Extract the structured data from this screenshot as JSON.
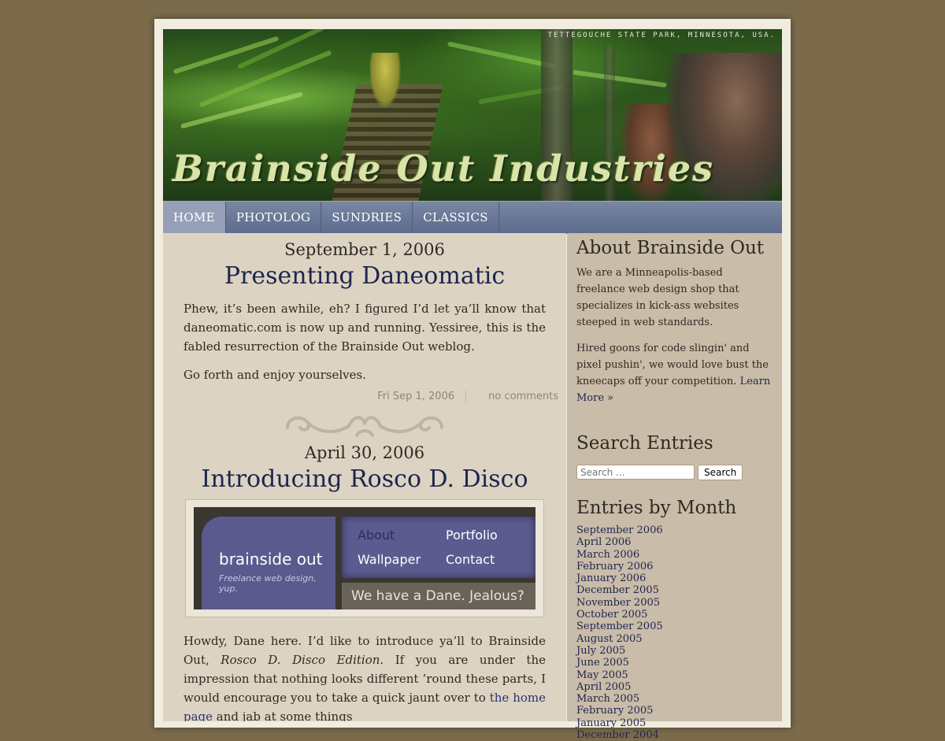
{
  "header": {
    "location": "TETTEGOUCHE STATE PARK, MINNESOTA, USA.",
    "site_title": "Brainside Out Industries"
  },
  "nav": {
    "items": [
      "HOME",
      "PHOTOLOG",
      "SUNDRIES",
      "CLASSICS"
    ],
    "active": "HOME"
  },
  "posts": [
    {
      "date": "September 1, 2006",
      "title": "Presenting Daneomatic",
      "p1_a": "Phew, it’s been awhile, eh? I figured I’d let ya’ll know that ",
      "p1_link": "daneomatic.com",
      "p1_b": " is now up and running. Yessiree, this is the fabled resurrection of the Brainside Out weblog.",
      "p2": "Go forth and enjoy yourselves.",
      "meta_date": "Fri Sep 1, 2006",
      "meta_comments": "no comments"
    },
    {
      "date": "April 30, 2006",
      "title": "Introducing Rosco D. Disco",
      "screenshot": {
        "logo": "brainside out",
        "tagline": "Freelance web design, yup.",
        "menu": [
          "About",
          "Portfolio",
          "Wallpaper",
          "Contact"
        ],
        "footer": "We have a Dane. Jealous?"
      },
      "p1_a": "Howdy, Dane here. I’d like to introduce ya’ll to Brainside Out, ",
      "p1_em": "Rosco D. Disco Edition",
      "p1_b": ". If you are under the impression that nothing looks different ’round these parts, I would encourage you to take a quick jaunt over to ",
      "p1_link": "the home page",
      "p1_c": " and jab at some things"
    }
  ],
  "sidebar": {
    "about_title": "About Brainside Out",
    "about_p1": "We are a Minneapolis-based freelance web design shop that specializes in kick-ass websites steeped in web standards.",
    "about_p2": "Hired goons for code slingin' and pixel pushin', we would love bust the kneecaps off your competition.",
    "learn_more": "Learn More »",
    "search_title": "Search Entries",
    "search_placeholder": "Search ...",
    "search_button": "Search",
    "months_title": "Entries by Month",
    "months": [
      "September 2006",
      "April 2006",
      "March 2006",
      "February 2006",
      "January 2006",
      "December 2005",
      "November 2005",
      "October 2005",
      "September 2005",
      "August 2005",
      "July 2005",
      "June 2005",
      "May 2005",
      "April 2005",
      "March 2005",
      "February 2005",
      "January 2005",
      "December 2004"
    ]
  },
  "colors": {
    "background": "#7b6b4b",
    "nav": "#5d6b8b",
    "link": "#1d2550"
  }
}
